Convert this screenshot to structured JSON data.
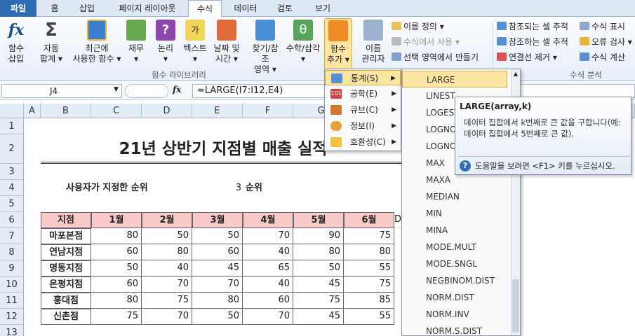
{
  "tabs": [
    "파일",
    "홈",
    "삽입",
    "페이지 레이아웃",
    "수식",
    "데이터",
    "검토",
    "보기"
  ],
  "ribbon": {
    "insert_function": "함수\n삽입",
    "autosum": "자동\n합계 ▾",
    "recent": "최근에\n사용한 함수 ▾",
    "finance": "재무\n▾",
    "logic": "논리\n▾",
    "text": "텍스트\n▾",
    "datetime": "날짜 및\n시간 ▾",
    "lookup": "찾기/참조\n영역 ▾",
    "math": "수학/삼각\n▾",
    "more_functions": "함수\n추가 ▾",
    "name_manager": "이름\n관리자",
    "define_name": "이름 정의 ▾",
    "use_in_formula": "수식에서 사용 ▾",
    "create_from_selection": "선택 영역에서 만들기",
    "trace_precedents": "참조되는 셀 추적",
    "trace_dependents": "참조하는 셀 추적",
    "remove_arrows": "연결선 제거 ▾",
    "show_formulas": "수식 표시",
    "error_checking": "오류 검사 ▾",
    "evaluate_formula": "수식 계산",
    "group_library": "함수 라이브러리",
    "group_audit": "수식 분석"
  },
  "formula_bar": {
    "name_box": "J4",
    "fx": "fx",
    "content": "=LARGE(I7:I12,E4)"
  },
  "columns": [
    "A",
    "B",
    "C",
    "D",
    "E",
    "F",
    "G"
  ],
  "rows": [
    "1",
    "2",
    "3",
    "4",
    "5",
    "6",
    "7",
    "8",
    "9",
    "10",
    "11",
    "12",
    "13"
  ],
  "sheet": {
    "title": "21년 상반기 지점별 매출 실적",
    "rank_label": "사용자가 지정한 순위",
    "rank_value": "3",
    "rank_unit": "순위",
    "headers": [
      "지점",
      "1월",
      "2월",
      "3월",
      "4월",
      "5월",
      "6월",
      "D"
    ],
    "rows": [
      {
        "name": "마포본점",
        "vals": [
          "80",
          "50",
          "50",
          "70",
          "90",
          "75"
        ]
      },
      {
        "name": "연남지점",
        "vals": [
          "60",
          "80",
          "60",
          "40",
          "80",
          "80"
        ]
      },
      {
        "name": "명동지점",
        "vals": [
          "50",
          "40",
          "45",
          "65",
          "50",
          "55"
        ]
      },
      {
        "name": "은평지점",
        "vals": [
          "60",
          "70",
          "70",
          "40",
          "45",
          "75"
        ]
      },
      {
        "name": "홍대점",
        "vals": [
          "80",
          "75",
          "80",
          "60",
          "75",
          "85"
        ]
      },
      {
        "name": "신촌점",
        "vals": [
          "75",
          "70",
          "50",
          "70",
          "45",
          "55"
        ]
      }
    ]
  },
  "menu_categories": [
    {
      "label": "통계(S)",
      "icon": "stats-icon"
    },
    {
      "label": "공학(E)",
      "icon": "engineering-icon"
    },
    {
      "label": "큐브(C)",
      "icon": "cube-icon"
    },
    {
      "label": "정보(I)",
      "icon": "info-icon"
    },
    {
      "label": "호환성(C)",
      "icon": "compat-icon"
    }
  ],
  "stat_functions": [
    "LARGE",
    "LINEST",
    "LOGEST",
    "LOGNO",
    "LOGNO",
    "MAX",
    "MAXA",
    "MEDIAN",
    "MIN",
    "MINA",
    "MODE.MULT",
    "MODE.SNGL",
    "NEGBINOM.DIST",
    "NORM.DIST",
    "NORM.INV",
    "NORM.S.DIST"
  ],
  "tooltip": {
    "title": "LARGE(array,k)",
    "body": "데이터 집합에서 k번째로 큰 값을 구합니다(예: 데이터 집합에서 5번째로 큰 값).",
    "help": "도움말을 보려면 <F1> 키를 누르십시오."
  }
}
